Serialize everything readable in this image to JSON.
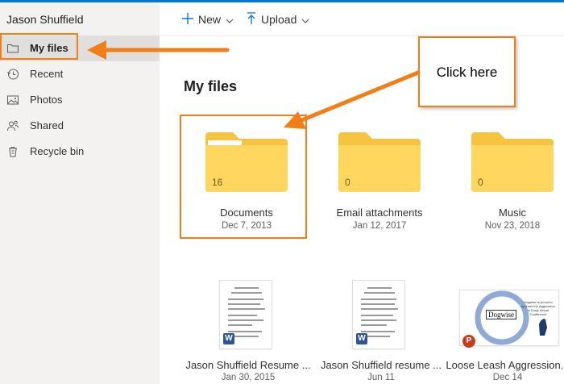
{
  "sidebar": {
    "user_name": "Jason Shuffield",
    "items": [
      {
        "label": "My files",
        "icon": "folder-icon",
        "selected": true
      },
      {
        "label": "Recent",
        "icon": "clock-icon"
      },
      {
        "label": "Photos",
        "icon": "photo-icon"
      },
      {
        "label": "Shared",
        "icon": "shared-people-icon"
      },
      {
        "label": "Recycle bin",
        "icon": "recycle-bin-icon"
      }
    ]
  },
  "toolbar": {
    "new_label": "New",
    "upload_label": "Upload"
  },
  "main": {
    "title": "My files",
    "folders": [
      {
        "name": "Documents",
        "date": "Dec 7, 2013",
        "count": "16"
      },
      {
        "name": "Email attachments",
        "date": "Jan 12, 2017",
        "count": "0"
      },
      {
        "name": "Music",
        "date": "Nov 23, 2018",
        "count": "0"
      }
    ],
    "files": [
      {
        "name": "Jason Shuffield Resume ...",
        "date": "Jan 30, 2015",
        "type": "word",
        "badge": "W"
      },
      {
        "name": "Jason Shuffield resume ...",
        "date": "Jun 11",
        "type": "word",
        "badge": "W"
      },
      {
        "name": "Loose Leash Aggression...",
        "date": "Dec 14",
        "type": "powerpoint",
        "badge": "P",
        "thumb_logo": "Dogwise",
        "thumb_text": "Dogwise is proud to sponsor the Aggression in Dogs Virtual Conference"
      }
    ]
  },
  "annotation": {
    "callout_text": "Click here",
    "color": "#f07f1a"
  },
  "colors": {
    "accent": "#0078d4",
    "folder": "#ffd75e",
    "folder_tab": "#f5c542",
    "sidebar_bg": "#f3f2f1",
    "selected_bg": "#e1dfdd"
  }
}
